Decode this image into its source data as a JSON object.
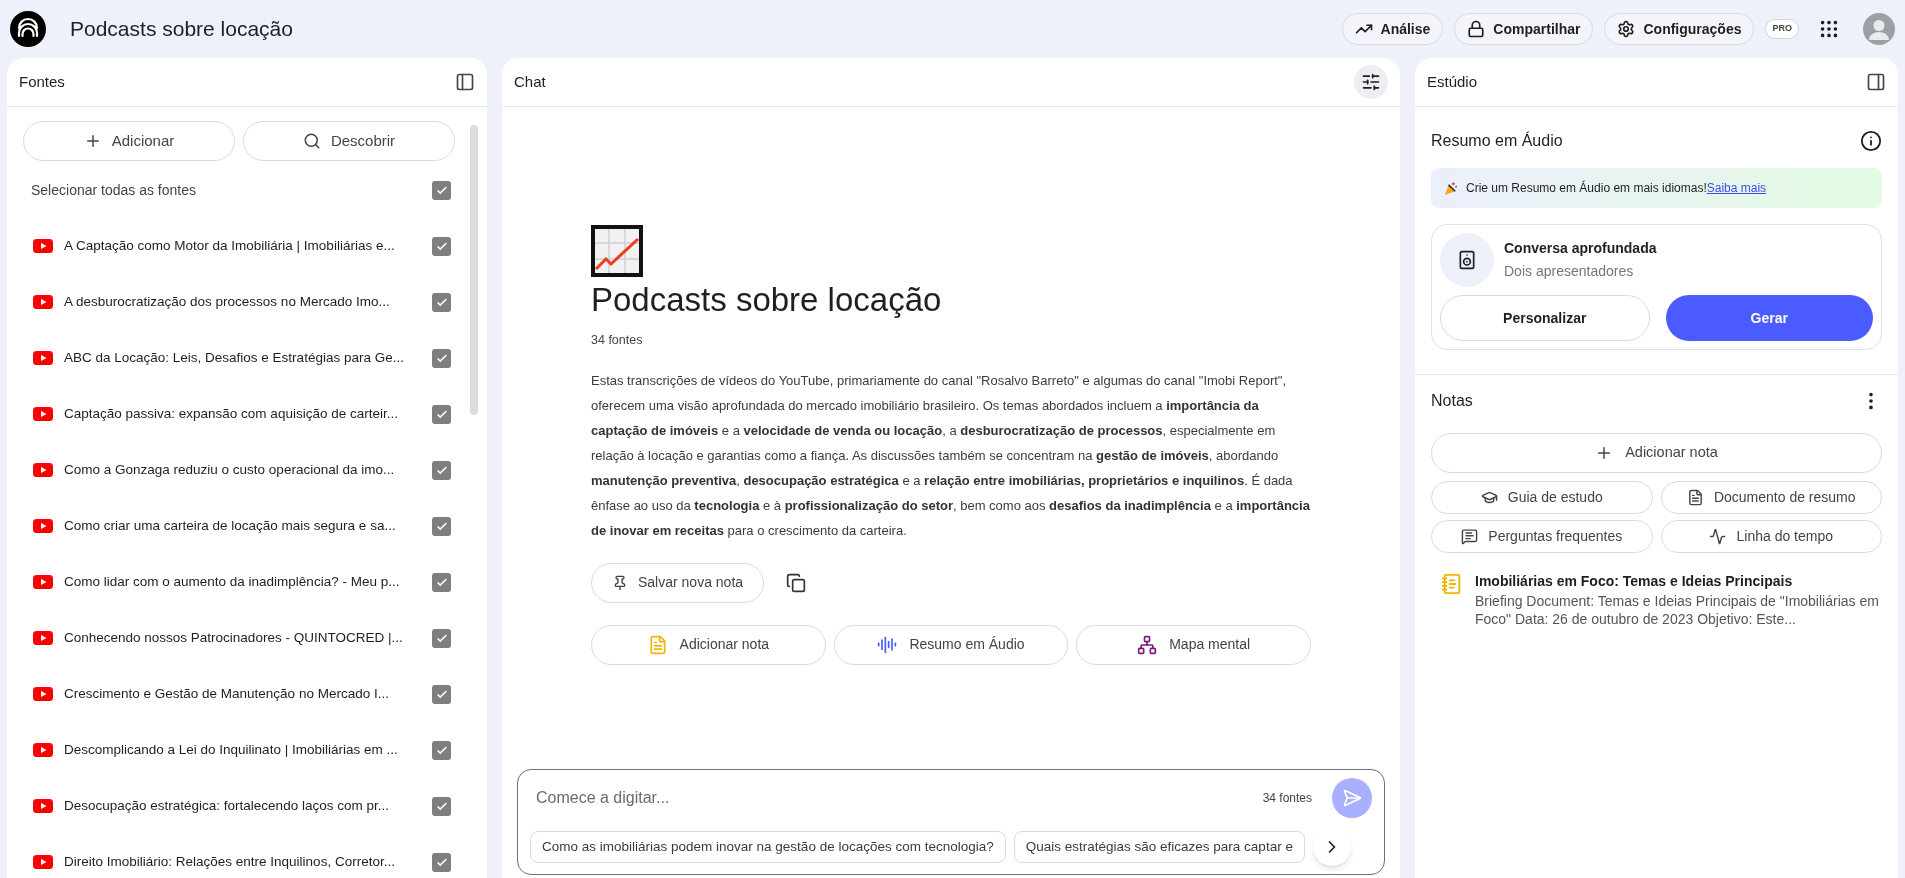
{
  "app": {
    "title": "Podcasts sobre locação",
    "badge": "PRO"
  },
  "header_buttons": [
    {
      "label": "Análise",
      "kind": "analytics"
    },
    {
      "label": "Compartilhar",
      "kind": "share"
    },
    {
      "label": "Configurações",
      "kind": "settings"
    }
  ],
  "sources_panel": {
    "title": "Fontes",
    "add_button": "Adicionar",
    "discover_button": "Descobrir",
    "select_all": {
      "label": "Selecionar todas as fontes",
      "checked": true
    },
    "items": [
      {
        "title": "A Captação como Motor da Imobiliária | Imobiliárias e...",
        "checked": true
      },
      {
        "title": "A desburocratização dos processos no Mercado Imo...",
        "checked": true
      },
      {
        "title": "ABC da Locação: Leis, Desafios e Estratégias para Ge...",
        "checked": true
      },
      {
        "title": "Captação passiva: expansão com aquisição de carteir...",
        "checked": true
      },
      {
        "title": "Como a Gonzaga reduziu o custo operacional da imo...",
        "checked": true
      },
      {
        "title": "Como criar uma carteira de locação mais segura e sa...",
        "checked": true
      },
      {
        "title": "Como lidar com o aumento da inadimplência? - Meu p...",
        "checked": true
      },
      {
        "title": "Conhecendo nossos Patrocinadores - QUINTOCRED |...",
        "checked": true
      },
      {
        "title": "Crescimento e Gestão de Manutenção no Mercado I...",
        "checked": true
      },
      {
        "title": "Descomplicando a Lei do Inquilinato | Imobiliárias em ...",
        "checked": true
      },
      {
        "title": "Desocupação estratégica: fortalecendo laços com pr...",
        "checked": true
      },
      {
        "title": "Direito Imobiliário: Relações entre Inquilinos, Corretor...",
        "checked": true
      }
    ]
  },
  "chat_panel": {
    "title": "Chat",
    "notebook": {
      "title": "Podcasts sobre locação",
      "source_count": "34 fontes",
      "summary": "Estas transcrições de vídeos do YouTube, primariamente do canal \"Rosalvo Barreto\" e algumas do canal \"Imobi Report\", oferecem uma visão aprofundada do mercado imobiliário brasileiro. Os temas abordados incluem a **importância da captação de imóveis** e a **velocidade de venda ou locação**, a **desburocratização de processos**, especialmente em relação à locação e garantias como a fiança. As discussões também se concentram na **gestão de imóveis**, abordando **manutenção preventiva**, **desocupação estratégica** e a **relação entre imobiliárias, proprietários e inquilinos**. É dada ênfase ao uso da **tecnologia** e à **profissionalização do setor**, bem como aos **desafios da inadimplência** e a **importância de inovar em receitas** para o crescimento da carteira."
    },
    "save_note_button": "Salvar nova nota",
    "actions": [
      {
        "label": "Adicionar nota",
        "kind": "note"
      },
      {
        "label": "Resumo em Áudio",
        "kind": "audio"
      },
      {
        "label": "Mapa mental",
        "kind": "mindmap"
      }
    ],
    "input": {
      "placeholder": "Comece a digitar...",
      "source_count": "34 fontes",
      "send_disabled": true
    },
    "suggestions": [
      "Como as imobiliárias podem inovar na gestão de locações com tecnologia?",
      "Quais estratégias são eficazes para captar e"
    ]
  },
  "studio_panel": {
    "title": "Estúdio",
    "audio": {
      "title": "Resumo em Áudio",
      "banner": {
        "text": "Crie um Resumo em Áudio em mais idiomas!",
        "link": "Saiba mais"
      },
      "format": {
        "title": "Conversa aprofundada",
        "subtitle": "Dois apresentadores"
      },
      "buttons": [
        {
          "label": "Personalizar",
          "kind": "secondary"
        },
        {
          "label": "Gerar",
          "kind": "primary"
        }
      ]
    },
    "notes": {
      "title": "Notas",
      "add_button": "Adicionar nota",
      "tools": [
        {
          "label": "Guia de estudo",
          "kind": "study"
        },
        {
          "label": "Documento de resumo",
          "kind": "briefing"
        },
        {
          "label": "Perguntas frequentes",
          "kind": "faq"
        },
        {
          "label": "Linha do tempo",
          "kind": "timeline"
        }
      ],
      "items": [
        {
          "title": "Imobiliárias em Foco: Temas e Ideias Principais",
          "preview": "Briefing Document: Temas e Ideias Principais de \"Imobiliárias em Foco\" Data: 26 de outubro de 2023 Objetivo: Este..."
        }
      ]
    }
  }
}
